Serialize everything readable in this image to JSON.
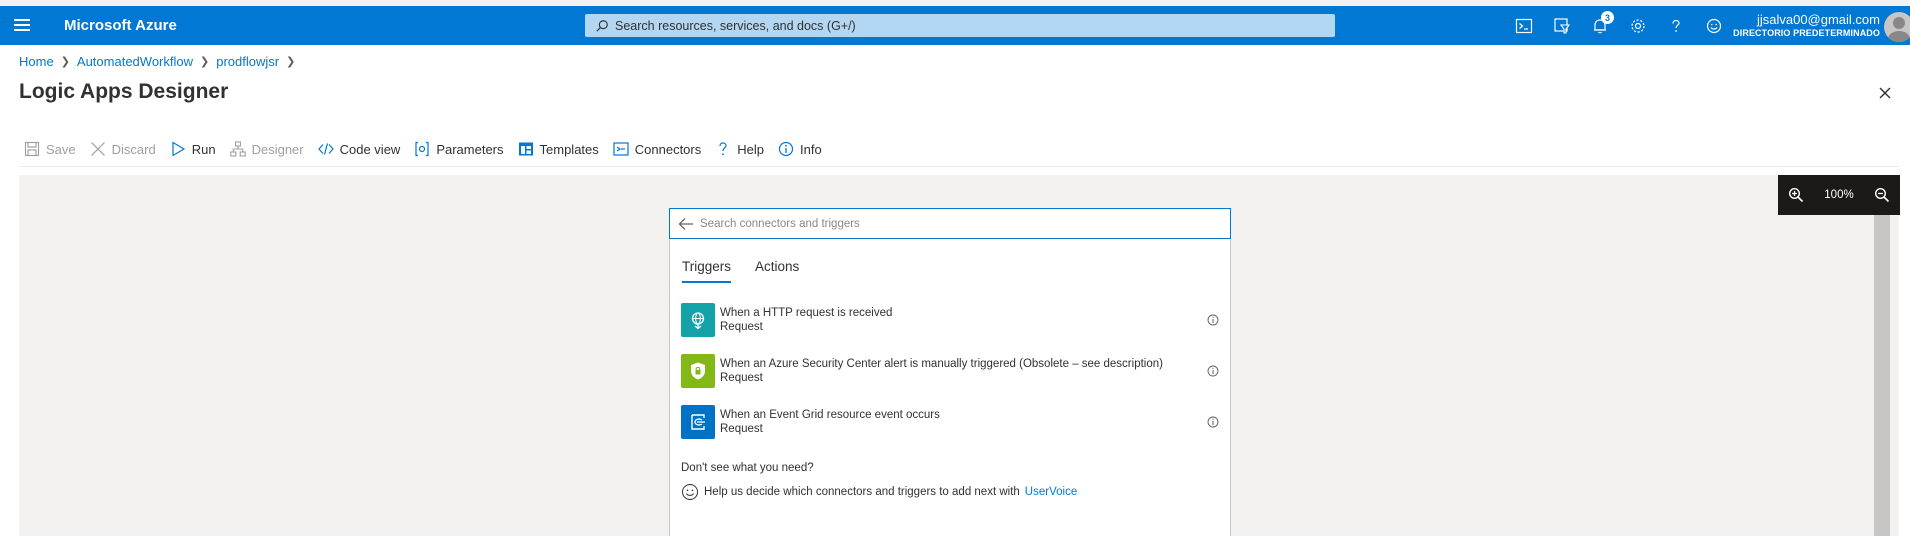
{
  "header": {
    "brand": "Microsoft Azure",
    "search_placeholder": "Search resources, services, and docs (G+/)",
    "notification_count": "3",
    "account_email": "jjsalva00@gmail.com",
    "account_directory": "DIRECTORIO PREDETERMINADO",
    "icons": [
      "cloud-shell-icon",
      "directory-filter-icon",
      "notifications-icon",
      "settings-icon",
      "help-icon",
      "feedback-icon"
    ]
  },
  "breadcrumb": {
    "items": [
      "Home",
      "AutomatedWorkflow",
      "prodflowjsr"
    ]
  },
  "page": {
    "title": "Logic Apps Designer"
  },
  "toolbar": {
    "save": "Save",
    "discard": "Discard",
    "run": "Run",
    "designer": "Designer",
    "code_view": "Code view",
    "parameters": "Parameters",
    "templates": "Templates",
    "connectors": "Connectors",
    "help": "Help",
    "info": "Info"
  },
  "zoom": {
    "level": "100%"
  },
  "panel": {
    "search_placeholder": "Search connectors and triggers",
    "tabs": [
      "Triggers",
      "Actions"
    ],
    "active_tab": "Triggers",
    "triggers": [
      {
        "name": "When a HTTP request is received",
        "sub": "Request",
        "color": "#13a2a8"
      },
      {
        "name": "When an Azure Security Center alert is manually triggered (Obsolete – see description)",
        "sub": "Request",
        "color": "#84b816"
      },
      {
        "name": "When an Event Grid resource event occurs",
        "sub": "Request",
        "color": "#0072c6"
      }
    ],
    "dont_see": "Don't see what you need?",
    "help_text": "Help us decide which connectors and triggers to add next with",
    "help_link": "UserVoice"
  },
  "colors": {
    "accent": "#0078d4",
    "topbar": "#0078d4",
    "canvas": "#f3f2f1"
  }
}
